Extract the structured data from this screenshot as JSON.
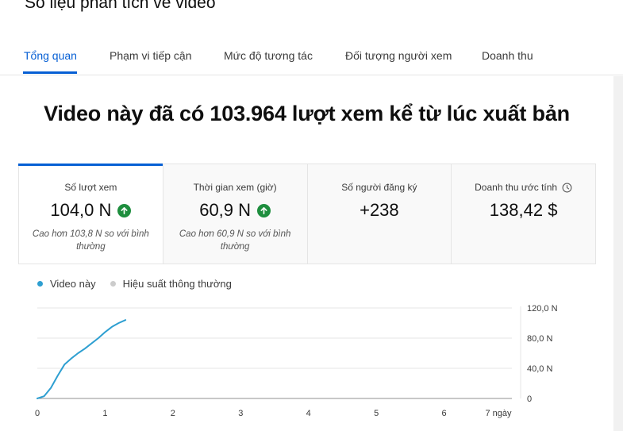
{
  "page": {
    "title": "Số liệu phân tích về video"
  },
  "tabs": [
    {
      "label": "Tổng quan",
      "active": true
    },
    {
      "label": "Phạm vi tiếp cận"
    },
    {
      "label": "Mức độ tương tác"
    },
    {
      "label": "Đối tượng người xem"
    },
    {
      "label": "Doanh thu"
    }
  ],
  "headline": "Video này đã có 103.964 lượt xem kể từ lúc xuất bản",
  "cards": [
    {
      "label": "Số lượt xem",
      "value": "104,0 N",
      "trend": "up",
      "note": "Cao hơn 103,8 N so với bình thường",
      "active": true
    },
    {
      "label": "Thời gian xem (giờ)",
      "value": "60,9 N",
      "trend": "up",
      "note": "Cao hơn 60,9 N so với bình thường"
    },
    {
      "label": "Số người đăng ký",
      "value": "+238"
    },
    {
      "label": "Doanh thu ước tính",
      "value": "138,42 $",
      "icon": "clock-icon"
    }
  ],
  "colors": {
    "accent": "#065fd4",
    "series": "#2e9fd1",
    "baseline": "#cccccc",
    "up": "#1e8e3e"
  },
  "chart_data": {
    "type": "line",
    "legend": [
      "Video này",
      "Hiệu suất thông thường"
    ],
    "x_ticks": [
      "0",
      "1",
      "2",
      "3",
      "4",
      "5",
      "6",
      "7 ngày"
    ],
    "y_ticks": [
      "0",
      "40,0 N",
      "80,0 N",
      "120,0 N"
    ],
    "xlim": [
      0,
      7
    ],
    "ylim": [
      0,
      120000
    ],
    "series": [
      {
        "name": "Video này",
        "x": [
          0,
          0.1,
          0.2,
          0.3,
          0.4,
          0.5,
          0.6,
          0.7,
          0.8,
          0.9,
          1.0,
          1.1,
          1.2,
          1.3
        ],
        "y": [
          0,
          3000,
          14000,
          30000,
          45000,
          53000,
          60000,
          66000,
          73000,
          80000,
          88000,
          95000,
          100000,
          104000
        ]
      }
    ]
  }
}
